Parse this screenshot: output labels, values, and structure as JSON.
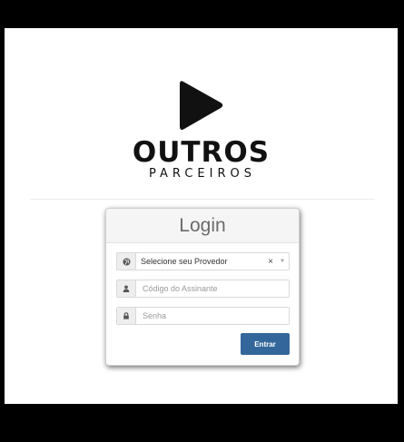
{
  "brand": {
    "name": "OUTROS",
    "tagline": "PARCEIROS"
  },
  "login": {
    "title": "Login",
    "provider": {
      "icon": "globe-icon",
      "value": "Selecione seu Provedor",
      "clear": "×",
      "caret": "▼"
    },
    "code": {
      "icon": "user-icon",
      "placeholder": "Código do Assinante"
    },
    "password": {
      "icon": "lock-icon",
      "placeholder": "Senha"
    },
    "submit_label": "Entrar"
  },
  "colors": {
    "accent": "#33679b",
    "brand": "#111111"
  }
}
